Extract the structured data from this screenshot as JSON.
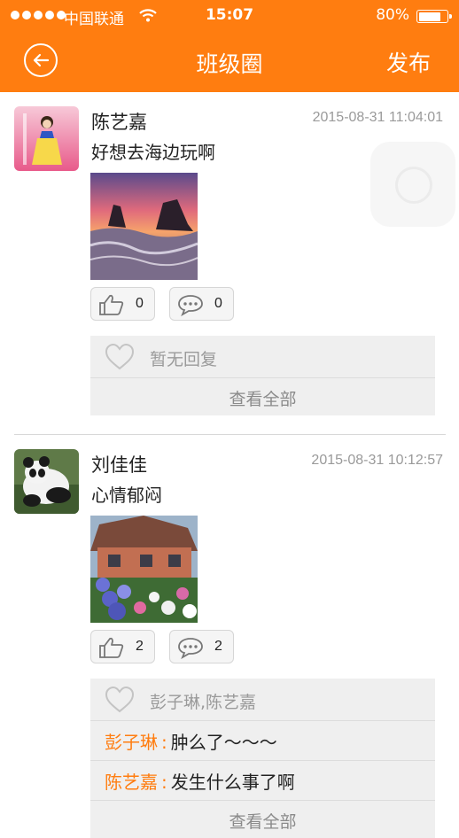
{
  "status_bar": {
    "carrier": "中国联通",
    "time": "15:07",
    "battery": "80%",
    "battery_level": 0.8
  },
  "nav": {
    "title": "班级圈",
    "publish_label": "发布",
    "back_icon": "back-arrow-circle-icon"
  },
  "posts": [
    {
      "user": "陈艺嘉",
      "time": "2015-08-31 11:04:01",
      "text": "好想去海边玩啊",
      "like_count": "0",
      "comment_count": "0",
      "likes_text": "暂无回复",
      "comments": [],
      "view_all_label": "查看全部"
    },
    {
      "user": "刘佳佳",
      "time": "2015-08-31 10:12:57",
      "text": "心情郁闷",
      "like_count": "2",
      "comment_count": "2",
      "likes_text": "彭子琳,陈艺嘉",
      "comments": [
        {
          "name": "彭子琳",
          "sep": ":",
          "text": "肿么了～～～"
        },
        {
          "name": "陈艺嘉",
          "sep": ":",
          "text": "发生什么事了啊"
        }
      ],
      "view_all_label": "查看全部"
    }
  ],
  "colors": {
    "accent": "#ff7d10",
    "reply_bg": "#efefef",
    "muted_text": "#9a9a9a"
  }
}
